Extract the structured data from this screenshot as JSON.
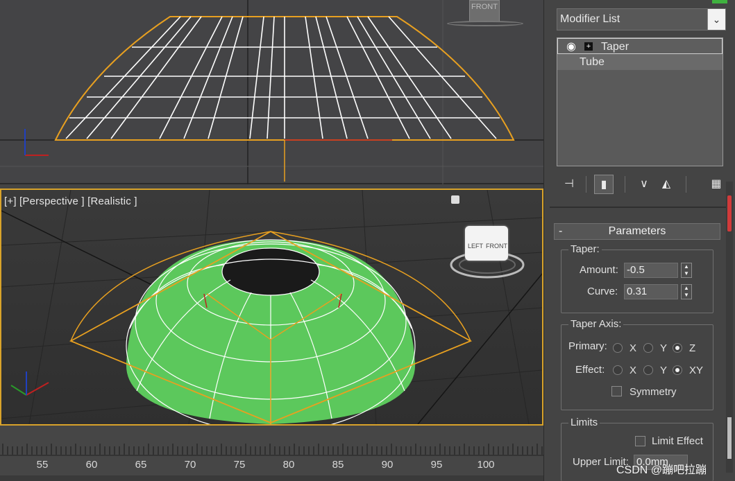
{
  "viewports": {
    "top_view_cube_label": "FRONT",
    "perspective_label": "[+] [Perspective ] [Realistic ]",
    "view_cube_faces": {
      "left": "LEFT",
      "front": "FRONT"
    },
    "axis_labels": {
      "x": "x",
      "y": "y",
      "z": "z"
    }
  },
  "timeline": {
    "ticks": [
      "55",
      "60",
      "65",
      "70",
      "75",
      "80",
      "85",
      "90",
      "95",
      "100"
    ]
  },
  "command_panel": {
    "modifier_list": "Modifier List",
    "stack": [
      {
        "label": "Taper",
        "selected": true
      },
      {
        "label": "Tube",
        "selected": false
      }
    ],
    "parameters_title": "Parameters",
    "collapse_symbol": "-",
    "taper_group": {
      "title": "Taper:",
      "amount_label": "Amount:",
      "amount_value": "-0.5",
      "curve_label": "Curve:",
      "curve_value": "0.31"
    },
    "axis_group": {
      "title": "Taper Axis:",
      "primary_label": "Primary:",
      "effect_label": "Effect:",
      "primary_options": [
        "X",
        "Y",
        "Z"
      ],
      "primary_selected": "Z",
      "effect_options": [
        "X",
        "Y",
        "XY"
      ],
      "effect_selected": "XY",
      "symmetry_label": "Symmetry"
    },
    "limits_group": {
      "title": "Limits",
      "limit_effect_label": "Limit Effect",
      "upper_limit_label": "Upper Limit:",
      "upper_limit_value": "0.0mm"
    }
  },
  "watermark": "CSDN @蹦吧拉蹦",
  "colors": {
    "accent_orange": "#e8a020",
    "mesh_green": "#5cc85c",
    "selection_yellow": "#d9a32a"
  }
}
